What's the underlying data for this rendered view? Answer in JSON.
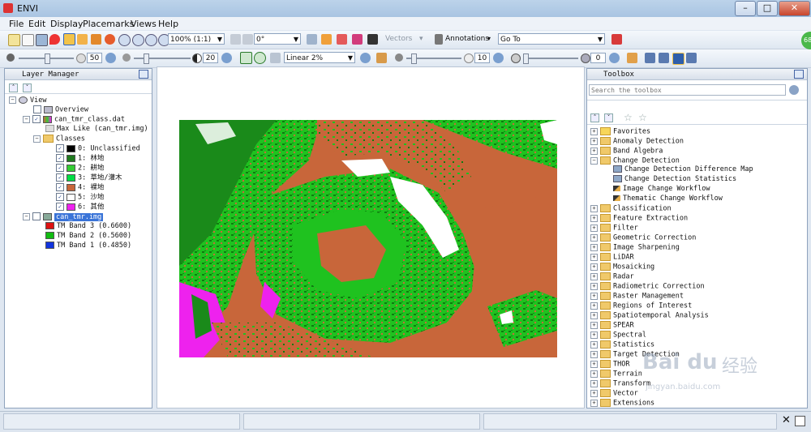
{
  "window": {
    "title": "ENVI"
  },
  "menus": [
    "File",
    "Edit",
    "Display",
    "Placemarks",
    "Views",
    "Help"
  ],
  "toolbar1": {
    "zoom": "100% (1:1)",
    "rotation": "0°",
    "vectors": "Vectors",
    "annotations": "Annotations",
    "goto": "Go To"
  },
  "toolbar2": {
    "brightness": "50",
    "contrast": "20",
    "stretch": "Linear 2%",
    "sharpen": "10",
    "transparency": "0"
  },
  "layer_manager": {
    "title": "Layer Manager",
    "items": [
      {
        "label": "View"
      },
      {
        "label": "Overview"
      },
      {
        "label": "can_tmr_class.dat"
      },
      {
        "label": "Max Like (can_tmr.img)"
      },
      {
        "label": "Classes"
      },
      {
        "label": "0: Unclassified",
        "color": "#000000"
      },
      {
        "label": "1: 林地",
        "color": "#1f7a1f"
      },
      {
        "label": "2: 耕地",
        "color": "#33cc33"
      },
      {
        "label": "3: 草地/灌木",
        "color": "#00dd44"
      },
      {
        "label": "4: 裸地",
        "color": "#c8663a"
      },
      {
        "label": "5: 沙地",
        "color": "#ffffff"
      },
      {
        "label": "6: 其他",
        "color": "#ee22ee"
      },
      {
        "label": "can_tmr.img"
      },
      {
        "label": "TM Band 3 (0.6600)",
        "color": "#dd1111"
      },
      {
        "label": "TM Band 2 (0.5600)",
        "color": "#11bb11"
      },
      {
        "label": "TM Band 1 (0.4850)",
        "color": "#1133dd"
      }
    ]
  },
  "toolbox": {
    "title": "Toolbox",
    "search_placeholder": "Search the toolbox",
    "items": [
      "Favorites",
      "Anomaly Detection",
      "Band Algebra",
      "Change Detection",
      "Change Detection Difference Map",
      "Change Detection Statistics",
      "Image Change Workflow",
      "Thematic Change Workflow",
      "Classification",
      "Feature Extraction",
      "Filter",
      "Geometric Correction",
      "Image Sharpening",
      "LiDAR",
      "Mosaicking",
      "Radar",
      "Radiometric Correction",
      "Raster Management",
      "Regions of Interest",
      "Spatiotemporal Analysis",
      "SPEAR",
      "Spectral",
      "Statistics",
      "Target Detection",
      "THOR",
      "Terrain",
      "Transform",
      "Vector",
      "Extensions"
    ]
  },
  "badge": "68",
  "watermark": {
    "brand": "Bai du",
    "text": "经验",
    "url": "jingyan.baidu.com"
  }
}
